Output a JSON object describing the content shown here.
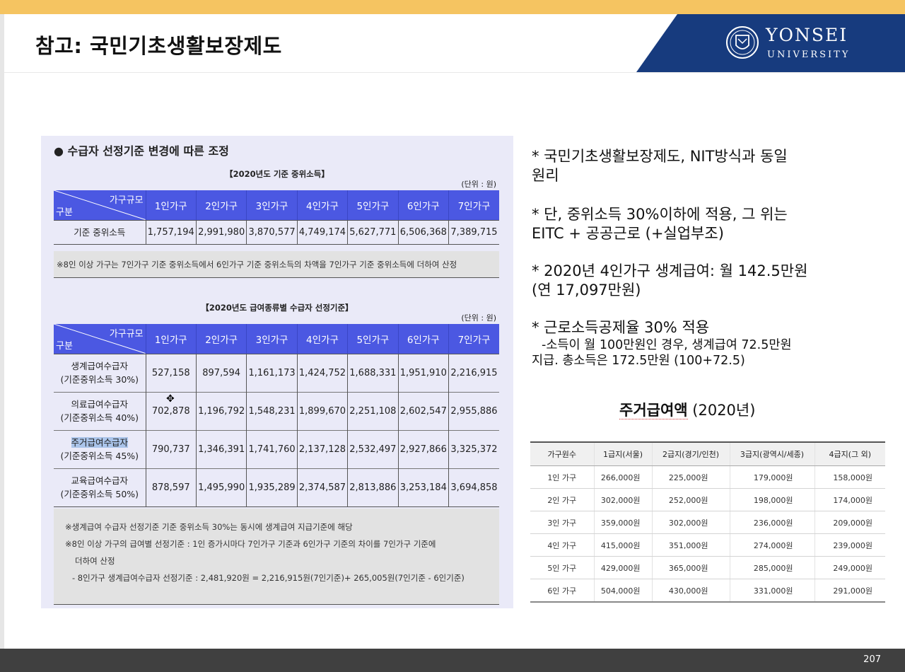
{
  "slide": {
    "title": "참고: 국민기초생활보장제도",
    "logo": {
      "name": "YONSEI",
      "sub": "UNIVERSITY",
      "brand_color": "#173b7e"
    },
    "page_number": "207"
  },
  "table_image": {
    "heading": "● 수급자 선정기준 변경에 따른 조정",
    "median_income": {
      "subtitle": "【2020년도 기준 중위소득】",
      "unit": "(단위 : 원)",
      "corner_top": "가구규모",
      "corner_bottom": "구분",
      "columns": [
        "1인가구",
        "2인가구",
        "3인가구",
        "4인가구",
        "5인가구",
        "6인가구",
        "7인가구"
      ],
      "row_label": "기준 중위소득",
      "values": [
        "1,757,194",
        "2,991,980",
        "3,870,577",
        "4,749,174",
        "5,627,771",
        "6,506,368",
        "7,389,715"
      ],
      "note": "※8인 이상 가구는 7인가구 기준 중위소득에서 6인가구 기준 중위소득의 차액을 7인가구 기준 중위소득에 더하여 산정"
    },
    "selection_criteria": {
      "subtitle": "【2020년도 급여종류별 수급자 선정기준】",
      "unit": "(단위 : 원)",
      "corner_top": "가구규모",
      "corner_bottom": "구분",
      "columns": [
        "1인가구",
        "2인가구",
        "3인가구",
        "4인가구",
        "5인가구",
        "6인가구",
        "7인가구"
      ],
      "rows": [
        {
          "label1": "생계급여수급자",
          "label2": "(기준중위소득 30%)",
          "values": [
            "527,158",
            "897,594",
            "1,161,173",
            "1,424,752",
            "1,688,331",
            "1,951,910",
            "2,216,915"
          ]
        },
        {
          "label1": "의료급여수급자",
          "label2": "(기준중위소득 40%)",
          "values": [
            "702,878",
            "1,196,792",
            "1,548,231",
            "1,899,670",
            "2,251,108",
            "2,602,547",
            "2,955,886"
          ]
        },
        {
          "label1": "주거급여수급자",
          "label2": "(기준중위소득 45%)",
          "values": [
            "790,737",
            "1,346,391",
            "1,741,760",
            "2,137,128",
            "2,532,497",
            "2,927,866",
            "3,325,372"
          ]
        },
        {
          "label1": "교육급여수급자",
          "label2": "(기준중위소득 50%)",
          "values": [
            "878,597",
            "1,495,990",
            "1,935,289",
            "2,374,587",
            "2,813,886",
            "3,253,184",
            "3,694,858"
          ]
        }
      ],
      "notes": [
        "※생계급여 수급자 선정기준 기준 중위소득 30%는 동시에 생계급여 지급기준에 해당",
        "※8인 이상 가구의 급여별 선정기준 : 1인 증가시마다 7인가구 기준과 6인가구 기준의 차이를 7인가구 기준에",
        "더하여 산정",
        "- 8인가구 생계급여수급자 선정기준 : 2,481,920원 = 2,216,915원(7인기준)+ 265,005원(7인기준 - 6인기준)"
      ]
    }
  },
  "right_text": {
    "b1_l1": "* 국민기초생활보장제도, NIT방식과 동일",
    "b1_l2": "원리",
    "b2_l1": "* 단, 중위소득 30%이하에 적용, 그 위는",
    "b2_l2": "EITC + 공공근로 (+실업부조)",
    "b3_l1": "* 2020년 4인가구 생계급여: 월 142.5만원",
    "b3_l2": "(연 17,097만원)",
    "b4_l1": "* 근로소득공제율 30% 적용",
    "b4_l2": "-소득이 월 100만원인 경우, 생계급여 72.5만원",
    "b4_l3": "지급. 총소득은 172.5만원 (100+72.5)"
  },
  "housing": {
    "title_bold": "주거급여액",
    "title_rest": " (2020년)",
    "columns": [
      "가구원수",
      "1급지(서울)",
      "2급지(경기/인천)",
      "3급지(광역시/세종)",
      "4급지(그 외)"
    ],
    "rows": [
      [
        "1인 가구",
        "266,000원",
        "225,000원",
        "179,000원",
        "158,000원"
      ],
      [
        "2인 가구",
        "302,000원",
        "252,000원",
        "198,000원",
        "174,000원"
      ],
      [
        "3인 가구",
        "359,000원",
        "302,000원",
        "236,000원",
        "209,000원"
      ],
      [
        "4인 가구",
        "415,000원",
        "351,000원",
        "274,000원",
        "239,000원"
      ],
      [
        "5인 가구",
        "429,000원",
        "365,000원",
        "285,000원",
        "249,000원"
      ],
      [
        "6인 가구",
        "504,000원",
        "430,000원",
        "331,000원",
        "291,000원"
      ]
    ]
  }
}
